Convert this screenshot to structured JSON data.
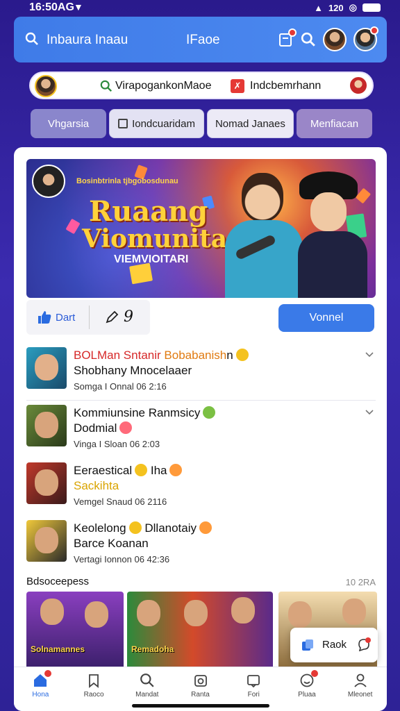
{
  "status_bar": {
    "time": "16:50AG",
    "right": "120"
  },
  "app_bar": {
    "title": "Inbaura Inaau",
    "center": "IFaoe"
  },
  "search_row": {
    "query": "VirapogankonMaoe",
    "tag_text": "Indcbemrhann"
  },
  "chips": [
    {
      "label": "Vhgarsia"
    },
    {
      "label": "Iondcuaridam"
    },
    {
      "label": "Nomad Janaes"
    },
    {
      "label": "Menfiacan"
    }
  ],
  "banner": {
    "small_text": "Bosinbtrinla tjbgobosdunau",
    "line1": "Ruaang",
    "line2": "Viomunitas",
    "line3": "VIEMVIOITARI"
  },
  "actions": {
    "like_label": "Dart",
    "count": "9",
    "primary_label": "Vonnel"
  },
  "list": [
    {
      "t1_red": "BOLMan Sntanir",
      "t1_orange": "Bobabanish",
      "t1_rest": "n",
      "t2": "Shobhany Mnocelaaer",
      "t3": "Somga I Onnal 06 2:16"
    },
    {
      "t1_red": "",
      "t1_orange": "",
      "t1_rest": "Kommiunsine Ranmsicy",
      "t2": "Dodmial",
      "t3": "Vinga I Sloan 06 2:03"
    },
    {
      "t1_red": "",
      "t1_orange": "",
      "t1_rest": "Eeraestical",
      "t1_after": "Iha",
      "t2": "Sackihta",
      "t3": "Vemgel Snaud 06 2116"
    },
    {
      "t1_red": "",
      "t1_orange": "",
      "t1_rest": "Keolelong",
      "t1_after": "Dllanotaiy",
      "t2": "Barce Koanan",
      "t3": "Vertagi Ionnon 06 42:36"
    }
  ],
  "section": {
    "header": "Bdsoceepess",
    "count": "10 2RA"
  },
  "gallery": [
    {
      "caption": "Solnamannes"
    },
    {
      "caption": "Remadoha"
    },
    {
      "caption": ""
    }
  ],
  "toast": {
    "label": "Raok"
  },
  "tabs": [
    {
      "label": "Hona",
      "icon": "home-icon",
      "active": true,
      "badge": true
    },
    {
      "label": "Raoco",
      "icon": "bookmark-icon",
      "active": false,
      "badge": false
    },
    {
      "label": "Mandat",
      "icon": "search-icon",
      "active": false,
      "badge": false
    },
    {
      "label": "Ranta",
      "icon": "camera-icon",
      "active": false,
      "badge": false
    },
    {
      "label": "Fori",
      "icon": "message-icon",
      "active": false,
      "badge": false
    },
    {
      "label": "Pluaa",
      "icon": "smiley-icon",
      "active": false,
      "badge": true
    },
    {
      "label": "Mleonet",
      "icon": "profile-icon",
      "active": false,
      "badge": false
    }
  ],
  "colors": {
    "accent": "#3a7ae8",
    "badge": "#e53935",
    "bg": "#2a1a8c"
  }
}
